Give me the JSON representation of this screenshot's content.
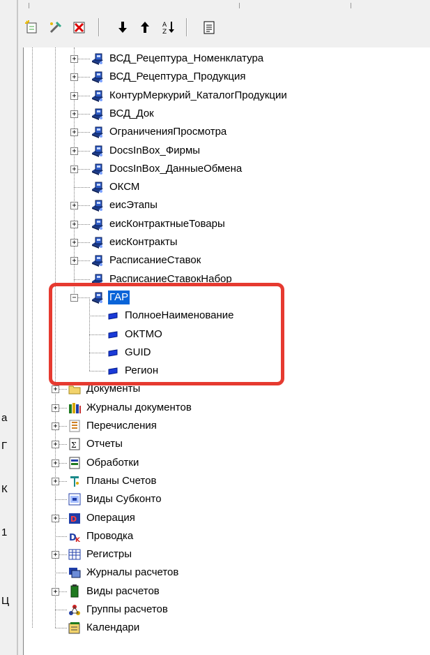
{
  "left_stub": {
    "chars": [
      "а",
      "Г",
      "К",
      "1",
      "Ц"
    ]
  },
  "toolbar": {
    "buttons": [
      {
        "name": "new-object-icon"
      },
      {
        "name": "properties-icon"
      },
      {
        "name": "delete-icon"
      },
      {
        "name": "move-down-icon"
      },
      {
        "name": "move-up-icon"
      },
      {
        "name": "sort-az-icon"
      },
      {
        "name": "description-icon"
      }
    ]
  },
  "tree": {
    "items": [
      {
        "label": "ВСД_Рецептура_Номенклатура",
        "icon": "register-icon",
        "level": 2,
        "expander": "+"
      },
      {
        "label": "ВСД_Рецептура_Продукция",
        "icon": "register-icon",
        "level": 2,
        "expander": "+"
      },
      {
        "label": "КонтурМеркурий_КаталогПродукции",
        "icon": "register-icon",
        "level": 2,
        "expander": "+"
      },
      {
        "label": "ВСД_Док",
        "icon": "register-icon",
        "level": 2,
        "expander": "+"
      },
      {
        "label": "ОграниченияПросмотра",
        "icon": "register-icon",
        "level": 2,
        "expander": "+"
      },
      {
        "label": "DocsInBox_Фирмы",
        "icon": "register-icon",
        "level": 2,
        "expander": "+"
      },
      {
        "label": "DocsInBox_ДанныеОбмена",
        "icon": "register-icon",
        "level": 2,
        "expander": "+"
      },
      {
        "label": "ОКСМ",
        "icon": "register-icon",
        "level": 2,
        "expander": ""
      },
      {
        "label": "еисЭтапы",
        "icon": "register-icon",
        "level": 2,
        "expander": "+"
      },
      {
        "label": "еисКонтрактныеТовары",
        "icon": "register-icon",
        "level": 2,
        "expander": "+"
      },
      {
        "label": "еисКонтракты",
        "icon": "register-icon",
        "level": 2,
        "expander": "+"
      },
      {
        "label": "РасписаниеСтавок",
        "icon": "register-icon",
        "level": 2,
        "expander": "+"
      },
      {
        "label": "РасписаниеСтавокНабор",
        "icon": "register-icon",
        "level": 2,
        "expander": "",
        "obscured": true
      },
      {
        "label": "ГАР",
        "icon": "register-icon",
        "level": 2,
        "expander": "−",
        "selected": true
      },
      {
        "label": "ПолноеНаименование",
        "icon": "attribute-icon",
        "level": 3,
        "expander": ""
      },
      {
        "label": "ОКТМО",
        "icon": "attribute-icon",
        "level": 3,
        "expander": ""
      },
      {
        "label": "GUID",
        "icon": "attribute-icon",
        "level": 3,
        "expander": ""
      },
      {
        "label": "Регион",
        "icon": "attribute-icon",
        "level": 3,
        "expander": ""
      },
      {
        "label": "Документы",
        "icon": "folder-icon",
        "level": 1,
        "expander": "+",
        "obscured": true
      },
      {
        "label": "Журналы документов",
        "icon": "journal-icon",
        "level": 1,
        "expander": "+"
      },
      {
        "label": "Перечисления",
        "icon": "enum-icon",
        "level": 1,
        "expander": "+"
      },
      {
        "label": "Отчеты",
        "icon": "report-icon",
        "level": 1,
        "expander": "+"
      },
      {
        "label": "Обработки",
        "icon": "processing-icon",
        "level": 1,
        "expander": "+"
      },
      {
        "label": "Планы Счетов",
        "icon": "chart-of-accounts-icon",
        "level": 1,
        "expander": "+"
      },
      {
        "label": "Виды Субконто",
        "icon": "subconto-icon",
        "level": 1,
        "expander": ""
      },
      {
        "label": "Операция",
        "icon": "operation-icon",
        "level": 1,
        "expander": "+"
      },
      {
        "label": "Проводка",
        "icon": "entry-icon",
        "level": 1,
        "expander": ""
      },
      {
        "label": "Регистры",
        "icon": "registers-icon",
        "level": 1,
        "expander": "+"
      },
      {
        "label": "Журналы расчетов",
        "icon": "calc-journal-icon",
        "level": 1,
        "expander": ""
      },
      {
        "label": "Виды расчетов",
        "icon": "calc-kind-icon",
        "level": 1,
        "expander": "+"
      },
      {
        "label": "Группы расчетов",
        "icon": "calc-group-icon",
        "level": 1,
        "expander": ""
      },
      {
        "label": "Календари",
        "icon": "calendar-icon",
        "level": 1,
        "expander": ""
      }
    ]
  },
  "colors": {
    "selection": "#0a64d8",
    "highlight_border": "#e63a30",
    "toolbar_bg": "#f0f0f0"
  }
}
